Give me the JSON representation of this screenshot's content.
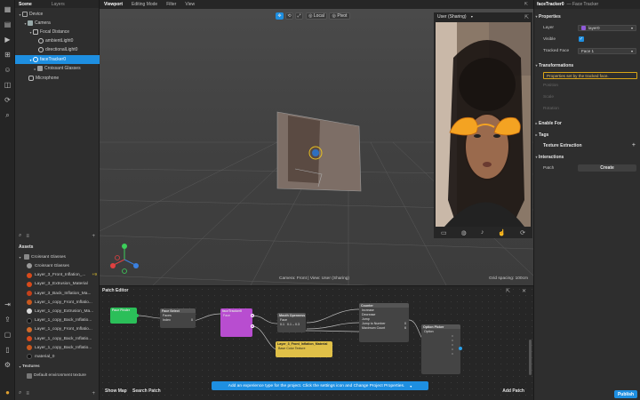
{
  "left_tools": [
    "scene-icon",
    "assets-icon",
    "play-icon",
    "grid-icon",
    "user-icon",
    "cube-icon",
    "sync-icon",
    "search-icon"
  ],
  "left_panel": {
    "tabs": [
      "Scene",
      "Layers"
    ],
    "scene_tree": [
      {
        "label": "Device",
        "indent": 0,
        "caret": "▾",
        "icon": "device"
      },
      {
        "label": "Camera",
        "indent": 1,
        "caret": "▾",
        "icon": "camera"
      },
      {
        "label": "Focal Distance",
        "indent": 2,
        "caret": "▾",
        "icon": "focal"
      },
      {
        "label": "ambientLight0",
        "indent": 3,
        "caret": "",
        "icon": "light"
      },
      {
        "label": "directionalLight0",
        "indent": 3,
        "caret": "",
        "icon": "light"
      },
      {
        "label": "faceTracker0",
        "indent": 2,
        "caret": "▾",
        "icon": "tracker",
        "selected": true
      },
      {
        "label": "Croissant Glasses",
        "indent": 3,
        "caret": "▸",
        "icon": "object"
      },
      {
        "label": "Microphone",
        "indent": 1,
        "caret": "",
        "icon": "mic"
      }
    ],
    "assets_title": "Assets",
    "assets_folder": "Croissant Glasses",
    "assets": [
      {
        "label": "Croissant Glasses",
        "color": "#9a9a9a"
      },
      {
        "label": "Layer_3_Front_Inflation_...",
        "color": "#d84a1b",
        "badge": "+9"
      },
      {
        "label": "Layer_3_Extrusion_Material",
        "color": "#d84a1b"
      },
      {
        "label": "Layer_3_Back_Inflation_Ma...",
        "color": "#c4401a"
      },
      {
        "label": "Layer_1_copy_Front_Inflatio...",
        "color": "#c9581e"
      },
      {
        "label": "Layer_1_copy_Extrusion_Ma...",
        "color": "#dadada"
      },
      {
        "label": "Layer_1_copy_Back_Inflatio...",
        "color": "#111111"
      },
      {
        "label": "Layer_1_copy_Front_Inflatio...",
        "color": "#d06a2a"
      },
      {
        "label": "Layer_1_copy_Back_Inflatio...",
        "color": "#d84a1b"
      },
      {
        "label": "Layer_1_copy_Back_Inflatio...",
        "color": "#c9581e"
      },
      {
        "label": "material_0",
        "color": "#111111"
      }
    ],
    "textures_title": "Textures",
    "textures": [
      {
        "label": "Default environment texture"
      }
    ]
  },
  "viewport": {
    "tabs": [
      "Viewport",
      "Editing Mode",
      "Filter",
      "View"
    ],
    "local_label": "Local",
    "pivot_label": "Pivot",
    "status": "Camera: Front | View: User (Sharing)",
    "grid_spacing": "Grid spacing: 100cm"
  },
  "preview": {
    "device_label": "User (Sharing)"
  },
  "patch_editor": {
    "title": "Patch Editor",
    "show_map": "Show Map",
    "search_patch": "Search Patch",
    "add_patch": "Add Patch",
    "notice": "Add an experience type for the project. Click the settings icon and Change Project Properties.",
    "nodes": {
      "face_finder": {
        "title": "Face Finder"
      },
      "face_select": {
        "title": "Face Select",
        "rows": [
          "Faces",
          "Index"
        ],
        "index_value": "0"
      },
      "face_tracker": {
        "title": "faceTracker0",
        "rows": [
          "Face"
        ]
      },
      "mouth_openness": {
        "title": "Mouth Openness",
        "rows": [
          "Face",
          "Openness"
        ],
        "range_label": "0.1",
        "range_value": "0.1 – 0.3"
      },
      "counter": {
        "title": "Counter",
        "rows": [
          "Increase",
          "Decrease",
          "Jump",
          "Jump to Number",
          "Maximum Count"
        ],
        "jump_value": "0",
        "max_value": "6"
      },
      "material": {
        "title": "Layer_3_Front_Inflation_Material",
        "rows": [
          "Base Color Texture"
        ]
      },
      "option_picker": {
        "title": "Option Picker",
        "rows": [
          "Option"
        ]
      }
    }
  },
  "right_panel": {
    "title": "faceTracker0",
    "subtitle": "— Face Tracker",
    "properties_title": "Properties",
    "layer_label": "Layer",
    "layer_value": "layer0",
    "visible_label": "Visible",
    "tracked_face_label": "Tracked Face",
    "tracked_face_value": "Face 1",
    "transformations_title": "Transformations",
    "transform_notice": "Properties set by the tracked face.",
    "position_label": "Position",
    "scale_label": "Scale",
    "rotation_label": "Rotation",
    "enable_for_title": "Enable For",
    "tags_title": "Tags",
    "texture_extraction_label": "Texture Extraction",
    "interactions_title": "Interactions",
    "patch_label": "Patch",
    "create_label": "Create",
    "publish_label": "Publish"
  },
  "colors": {
    "accent": "#1e8fe1",
    "selection": "#1e8fe1",
    "warning_outline": "#d9a416"
  }
}
